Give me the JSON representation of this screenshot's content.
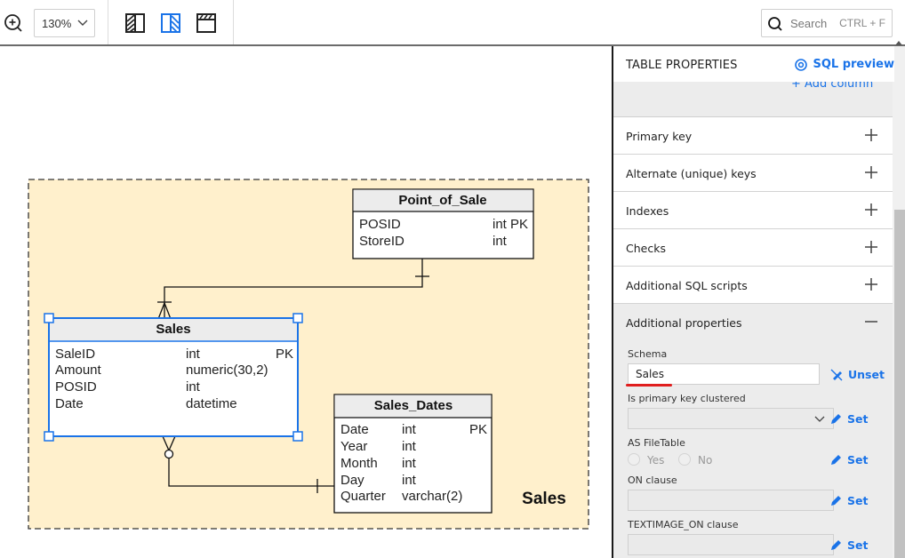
{
  "toolbar": {
    "zoom_icon": "zoom-in-icon",
    "zoom_level": "130%",
    "layout_buttons": [
      {
        "name": "layout-left-panel-icon",
        "active": false
      },
      {
        "name": "layout-right-panel-icon",
        "active": true
      },
      {
        "name": "layout-top-panel-icon",
        "active": false
      }
    ],
    "search_placeholder": "Search",
    "search_shortcut": "CTRL + F"
  },
  "diagram": {
    "subject_area": {
      "label": "Sales",
      "fill": "#fff0cc"
    },
    "tables": [
      {
        "name": "Point_of_Sale",
        "selected": false,
        "columns": [
          {
            "name": "POSID",
            "type": "int PK",
            "key": ""
          },
          {
            "name": "StoreID",
            "type": "int",
            "key": ""
          }
        ]
      },
      {
        "name": "Sales",
        "selected": true,
        "columns": [
          {
            "name": "SaleID",
            "type": "int",
            "key": "PK"
          },
          {
            "name": "Amount",
            "type": "numeric(30,2)",
            "key": ""
          },
          {
            "name": "POSID",
            "type": "int",
            "key": ""
          },
          {
            "name": "Date",
            "type": "datetime",
            "key": ""
          }
        ]
      },
      {
        "name": "Sales_Dates",
        "selected": false,
        "columns": [
          {
            "name": "Date",
            "type": "int",
            "key": "PK"
          },
          {
            "name": "Year",
            "type": "int",
            "key": ""
          },
          {
            "name": "Month",
            "type": "int",
            "key": ""
          },
          {
            "name": "Day",
            "type": "int",
            "key": ""
          },
          {
            "name": "Quarter",
            "type": "varchar(2)",
            "key": ""
          }
        ]
      }
    ],
    "relationships": [
      {
        "from": "Point_of_Sale",
        "to": "Sales",
        "from_card": "one",
        "to_card": "one-or-many"
      },
      {
        "from": "Sales_Dates",
        "to": "Sales",
        "from_card": "one",
        "to_card": "zero-or-many"
      }
    ],
    "colors": {
      "selection": "#1a73e8",
      "header_fill": "#ececec"
    }
  },
  "panel": {
    "title": "TABLE PROPERTIES",
    "sql_preview": "SQL preview",
    "add_column": "+ Add column",
    "sections": [
      {
        "label": "Primary key",
        "expanded": false
      },
      {
        "label": "Alternate (unique) keys",
        "expanded": false
      },
      {
        "label": "Indexes",
        "expanded": false
      },
      {
        "label": "Checks",
        "expanded": false
      },
      {
        "label": "Additional SQL scripts",
        "expanded": false
      },
      {
        "label": "Additional properties",
        "expanded": true
      }
    ],
    "properties": {
      "schema": {
        "label": "Schema",
        "value": "Sales",
        "action": "Unset"
      },
      "pk_clustered": {
        "label": "Is primary key clustered",
        "value": "",
        "action": "Set"
      },
      "as_filetable": {
        "label": "AS FileTable",
        "options": [
          "Yes",
          "No"
        ],
        "selected": null,
        "action": "Set"
      },
      "on_clause": {
        "label": "ON clause",
        "value": "",
        "action": "Set"
      },
      "textimage_on": {
        "label": "TEXTIMAGE_ON clause",
        "value": "",
        "action": "Set"
      }
    },
    "accent": "#1a73e8"
  }
}
